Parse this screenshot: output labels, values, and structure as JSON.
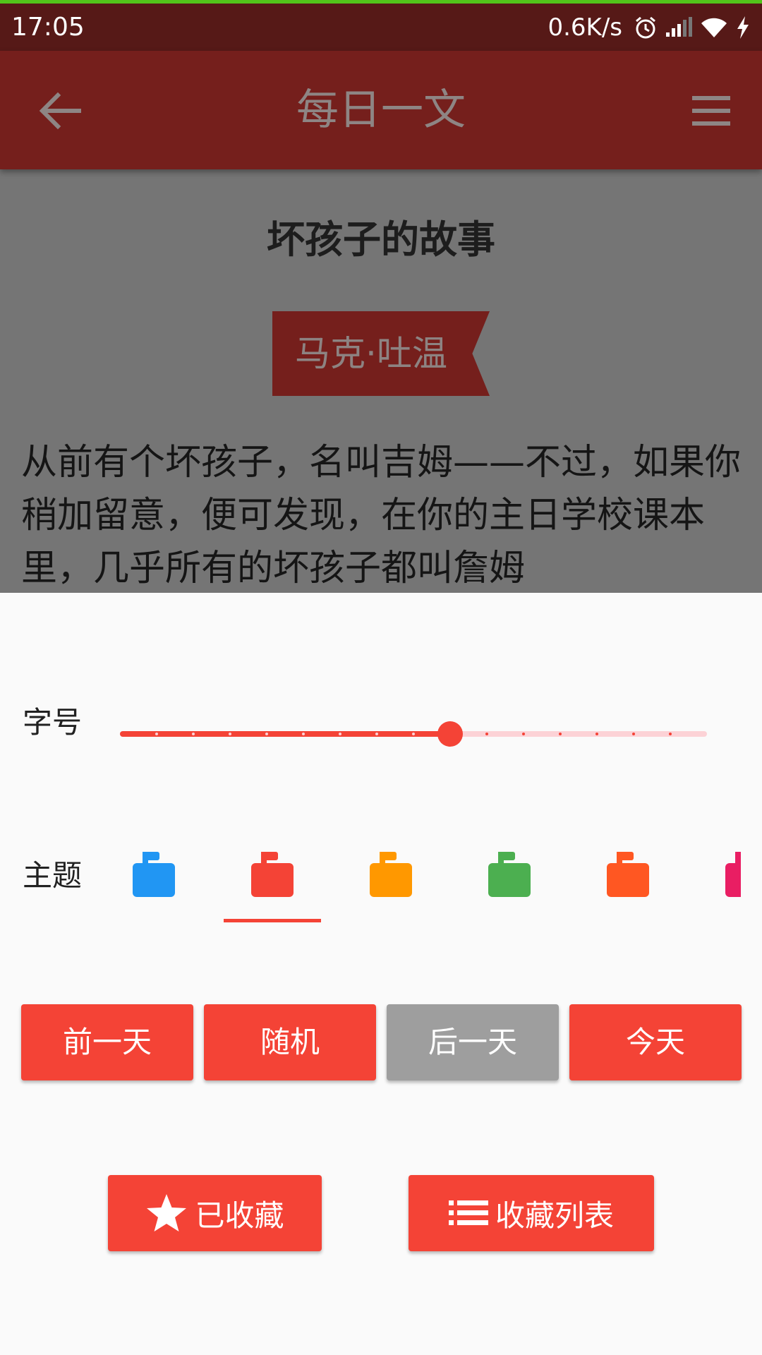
{
  "status_bar": {
    "time": "17:05",
    "speed": "0.6K/s",
    "icons": [
      "alarm-icon",
      "signal-icon",
      "wifi-icon",
      "charging-icon"
    ]
  },
  "app_bar": {
    "title": "每日一文",
    "back_icon": "arrow-back-icon",
    "menu_icon": "menu-icon"
  },
  "article": {
    "title": "坏孩子的故事",
    "author": "马克·吐温",
    "body": "从前有个坏孩子，名叫吉姆——不过，如果你稍加留意，便可发现，在你的主日学校课本里，几乎所有的坏孩子都叫詹姆"
  },
  "settings": {
    "font_size_label": "字号",
    "font_size_slider": {
      "steps": 16,
      "value_step": 9
    },
    "theme_label": "主题",
    "themes": [
      {
        "name": "blue",
        "color": "#2196f3"
      },
      {
        "name": "red",
        "color": "#f44336"
      },
      {
        "name": "orange",
        "color": "#ff9800"
      },
      {
        "name": "green",
        "color": "#4caf50"
      },
      {
        "name": "deep-orange",
        "color": "#ff5722"
      },
      {
        "name": "pink",
        "color": "#e91e63"
      }
    ],
    "selected_theme": 1,
    "accent_color": "#f44336",
    "disabled_color": "#9e9e9e"
  },
  "buttons": {
    "prev_day": "前一天",
    "random": "随机",
    "next_day": "后一天",
    "today": "今天",
    "favorited": "已收藏",
    "favorites_list": "收藏列表"
  }
}
